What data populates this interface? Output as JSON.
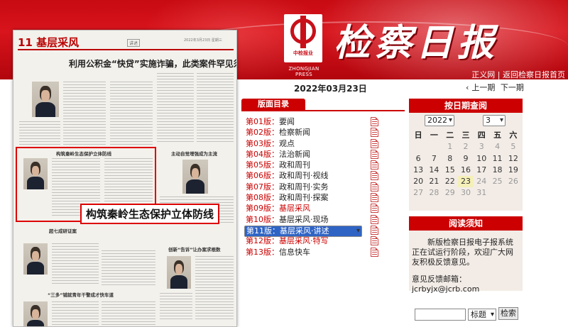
{
  "header": {
    "brand": "检察日报",
    "logo_cn": "中检报业",
    "logo_en": "ZHONGJIAN PRESS",
    "top_links": "正义网 | 返回检察日报首页"
  },
  "paper": {
    "masthead": "11 基层采风",
    "tag": "讲述",
    "pubinfo": "2022年3月23日 星期三",
    "lead_title": "利用公积金“快贷”实施诈骗，此类案件罕见须警惕!",
    "sub_titles": [
      "构筑秦岭生态保护立体防线",
      "主动自觉增强成为主流",
      "超七成研证案",
      "创新“告诉”让办案求根数",
      "“三多”铺就青年干警成才快车道"
    ],
    "callout": "构筑秦岭生态保护立体防线"
  },
  "issue_date": "2022年03月23日",
  "pager": {
    "prev": "上一期",
    "next": "下一期"
  },
  "sections": {
    "header": "版面目录",
    "items": [
      {
        "num": "第01版：",
        "title": "要闻",
        "style": "red-num"
      },
      {
        "num": "第02版：",
        "title": "检察新闻",
        "style": ""
      },
      {
        "num": "第03版：",
        "title": "观点",
        "style": ""
      },
      {
        "num": "第04版：",
        "title": "法治新闻",
        "style": ""
      },
      {
        "num": "第05版：",
        "title": "政和周刊",
        "style": ""
      },
      {
        "num": "第06版：",
        "title": "政和周刊·视线",
        "style": ""
      },
      {
        "num": "第07版：",
        "title": "政和周刊·实务",
        "style": ""
      },
      {
        "num": "第08版：",
        "title": "政和周刊·探案",
        "style": ""
      },
      {
        "num": "第09版：",
        "title": "基层采风",
        "style": "red"
      },
      {
        "num": "第10版：",
        "title": "基层采风·现场",
        "style": ""
      },
      {
        "num": "第11版：",
        "title": "基层采风·讲述",
        "style": "selected"
      },
      {
        "num": "第12版：",
        "title": "基层采风·特写",
        "style": "red"
      },
      {
        "num": "第13版：",
        "title": "信息快车",
        "style": ""
      }
    ]
  },
  "calendar": {
    "header": "按日期查阅",
    "year": "2022",
    "month": "3",
    "weekdays": [
      "日",
      "一",
      "二",
      "三",
      "四",
      "五",
      "六"
    ],
    "days": [
      {
        "d": "",
        "c": ""
      },
      {
        "d": "",
        "c": ""
      },
      {
        "d": "1",
        "c": "gray"
      },
      {
        "d": "2",
        "c": "gray"
      },
      {
        "d": "3",
        "c": "gray"
      },
      {
        "d": "4",
        "c": "gray"
      },
      {
        "d": "5",
        "c": "gray"
      },
      {
        "d": "6",
        "c": ""
      },
      {
        "d": "7",
        "c": ""
      },
      {
        "d": "8",
        "c": ""
      },
      {
        "d": "9",
        "c": ""
      },
      {
        "d": "10",
        "c": ""
      },
      {
        "d": "11",
        "c": ""
      },
      {
        "d": "12",
        "c": ""
      },
      {
        "d": "13",
        "c": ""
      },
      {
        "d": "14",
        "c": ""
      },
      {
        "d": "15",
        "c": ""
      },
      {
        "d": "16",
        "c": ""
      },
      {
        "d": "17",
        "c": ""
      },
      {
        "d": "18",
        "c": ""
      },
      {
        "d": "19",
        "c": ""
      },
      {
        "d": "20",
        "c": ""
      },
      {
        "d": "21",
        "c": ""
      },
      {
        "d": "22",
        "c": ""
      },
      {
        "d": "23",
        "c": "today"
      },
      {
        "d": "24",
        "c": "gray"
      },
      {
        "d": "25",
        "c": "gray"
      },
      {
        "d": "26",
        "c": "gray"
      },
      {
        "d": "27",
        "c": "gray"
      },
      {
        "d": "28",
        "c": "gray"
      },
      {
        "d": "29",
        "c": "gray"
      },
      {
        "d": "30",
        "c": "gray"
      },
      {
        "d": "31",
        "c": "gray"
      },
      {
        "d": "",
        "c": ""
      },
      {
        "d": "",
        "c": ""
      }
    ]
  },
  "notice": {
    "header": "阅读须知",
    "body": "新版检察日报电子报系统正在试运行阶段，欢迎广大网友积极反馈意见。",
    "email": "意见反馈邮箱：jcrbyjx@jcrb.com"
  },
  "search": {
    "type": "标题",
    "button": "检索"
  },
  "colors": {
    "brand_red": "#c80a12",
    "selected_blue": "#2f64c5",
    "panel_bg": "#f3ece6"
  }
}
